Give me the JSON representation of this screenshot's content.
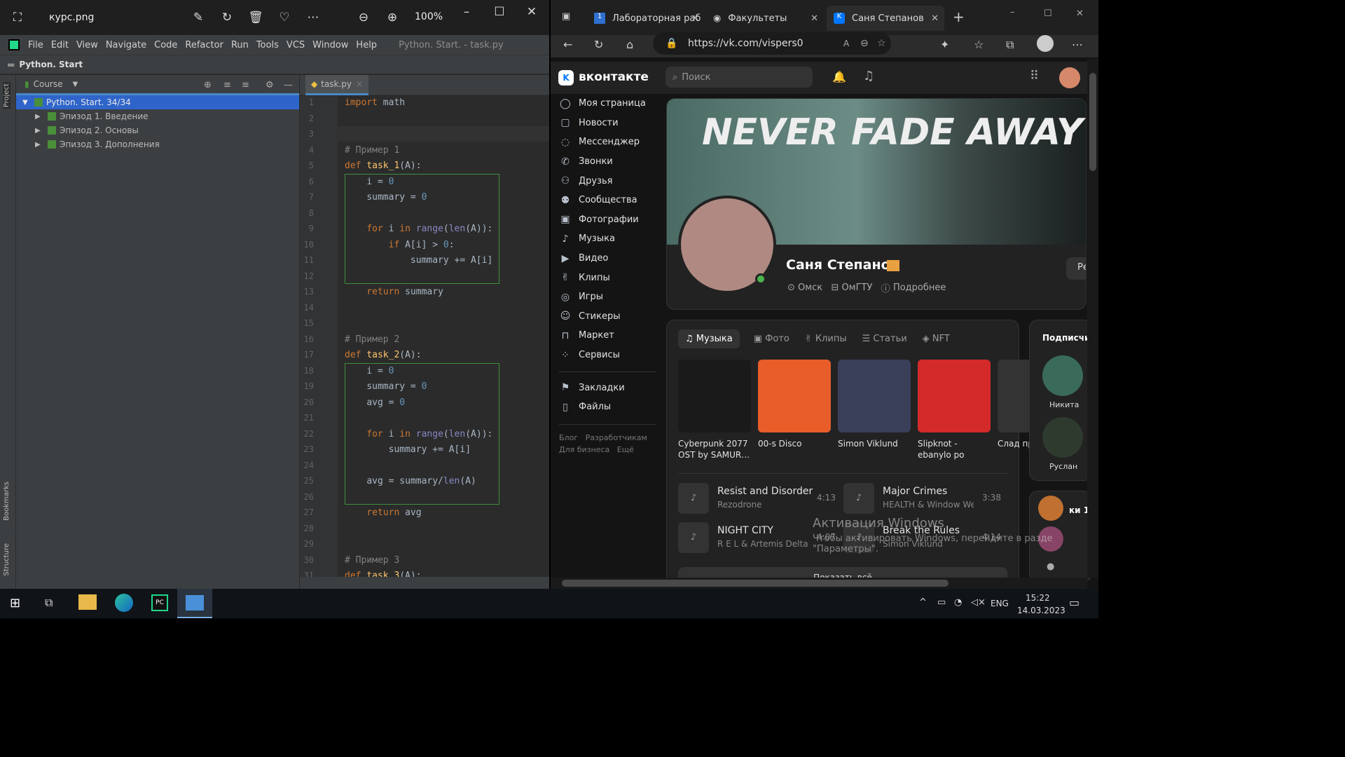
{
  "viewer": {
    "filename": "курс.png",
    "zoom": "100%"
  },
  "ide": {
    "menu": [
      "File",
      "Edit",
      "View",
      "Navigate",
      "Code",
      "Refactor",
      "Run",
      "Tools",
      "VCS",
      "Window",
      "Help"
    ],
    "window_title": "Python. Start. - task.py",
    "nav_project": "Python. Start",
    "panel_title": "Course",
    "side_tabs": {
      "project": "Project",
      "bookmarks": "Bookmarks",
      "structure": "Structure"
    },
    "tree": [
      "Python. Start.  34/34",
      "Эпизод 1. Введение",
      "Эпизод 2. Основы",
      "Эпизод 3. Дополнения"
    ],
    "tab": "task.py",
    "line_numbers": [
      "1",
      "2",
      "3",
      "4",
      "5",
      "6",
      "7",
      "8",
      "9",
      "10",
      "11",
      "12",
      "13",
      "14",
      "15",
      "16",
      "17",
      "18",
      "19",
      "20",
      "21",
      "22",
      "23",
      "24",
      "25",
      "26",
      "27",
      "28",
      "29",
      "30",
      "31"
    ],
    "code": {
      "l1_kw": "import",
      "l1_rest": " math",
      "c1": "# Пример 1",
      "def": "def",
      "f1": "task_1",
      "args": "(A):",
      "l6": "i = ",
      "zero": "0",
      "l7": "summary = ",
      "for": "for",
      "l9a": " i ",
      "in": "in",
      "range": "range",
      "len": "len",
      "l9b": "(A)):",
      "if": "if",
      "l10a": " A[i] > ",
      "l10b": ":",
      "l11": "summary += A[i]",
      "ret": "return",
      "l13": " summary",
      "c2": "# Пример 2",
      "f2": "task_2",
      "l20": "avg = ",
      "l23": "summary += A[i]",
      "l25a": "avg = summary/",
      "l25b": "(A)",
      "l27": " avg",
      "c3": "# Пример 3",
      "f3": "task_3"
    }
  },
  "browser": {
    "tabs": [
      "Лабораторная раб",
      "Факультеты",
      "Саня Степанов"
    ],
    "url": "https://vk.com/vispers0",
    "vk": {
      "logo": "вконтакте",
      "search_placeholder": "Поиск",
      "menu": [
        "Моя страница",
        "Новости",
        "Мессенджер",
        "Звонки",
        "Друзья",
        "Сообщества",
        "Фотографии",
        "Музыка",
        "Видео",
        "Клипы",
        "Игры",
        "Стикеры",
        "Маркет",
        "Сервисы"
      ],
      "menu2": [
        "Закладки",
        "Файлы"
      ],
      "footer": [
        "Блог",
        "Разработчикам",
        "Для бизнеса",
        "Ещё"
      ],
      "cover_text": "NEVER FADE AWAY",
      "profile_name": "Саня Степанов",
      "city": "Омск",
      "university": "ОмГТУ",
      "more": "Подробнее",
      "edit_btn": "Ре",
      "content_tabs": [
        "Музыка",
        "Фото",
        "Клипы",
        "Статьи",
        "NFT"
      ],
      "albums": [
        {
          "title": "Cyberpunk 2077 OST by SAMUR…",
          "color": "#1a1a1a"
        },
        {
          "title": "00-s Disco",
          "color": "#e85d2a"
        },
        {
          "title": "Simon Viklund",
          "color": "#3a3f5a"
        },
        {
          "title": "Slipknot - ebanylo po bashke",
          "color": "#d42a2a"
        },
        {
          "title": "Слад прив",
          "color": "#333"
        }
      ],
      "tracks": [
        {
          "title": "Resist and Disorder",
          "artist": "Rezodrone",
          "dur": "4:13"
        },
        {
          "title": "Major Crimes",
          "artist": "HEALTH & Window We…",
          "dur": "3:38"
        },
        {
          "title": "NIGHT CITY",
          "artist": "R E L & Artemis Delta",
          "dur": "4:07"
        },
        {
          "title": "Break the Rules",
          "artist": "Simon Viklund",
          "dur": "4:14"
        }
      ],
      "show_all": "Показать всё",
      "subs_title": "Подписчи",
      "subs": [
        "Никита",
        "Руслан"
      ],
      "side2": "ки 1",
      "watermark1": "Активация Windows",
      "watermark2": "Чтобы активировать Windows, перейдите в разде",
      "watermark3": "\"Параметры\"."
    }
  },
  "taskbar": {
    "lang": "ENG",
    "time": "15:22",
    "date": "14.03.2023"
  }
}
